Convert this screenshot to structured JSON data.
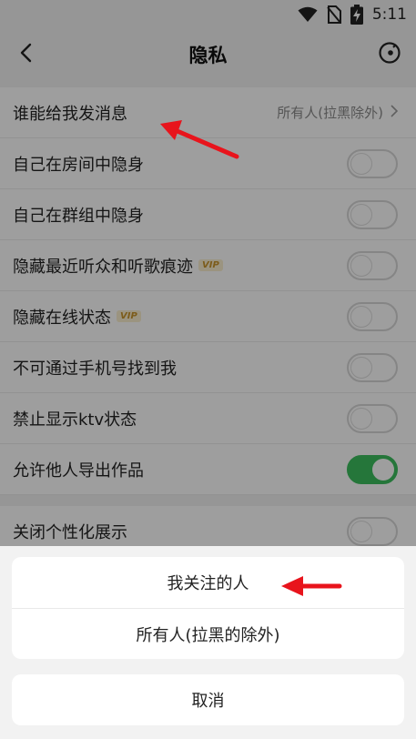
{
  "status_bar": {
    "time": "5:11"
  },
  "header": {
    "title": "隐私"
  },
  "settings": {
    "message_permission": {
      "label": "谁能给我发消息",
      "value": "所有人(拉黑除外)"
    },
    "toggles": [
      {
        "label": "自己在房间中隐身",
        "vip": "",
        "on": false
      },
      {
        "label": "自己在群组中隐身",
        "vip": "",
        "on": false
      },
      {
        "label": "隐藏最近听众和听歌痕迹",
        "vip": "VIP",
        "on": false
      },
      {
        "label": "隐藏在线状态",
        "vip": "VIP",
        "on": false
      },
      {
        "label": "不可通过手机号找到我",
        "vip": "",
        "on": false
      },
      {
        "label": "禁止显示ktv状态",
        "vip": "",
        "on": false
      },
      {
        "label": "允许他人导出作品",
        "vip": "",
        "on": true
      }
    ],
    "personalized": {
      "label": "关闭个性化展示",
      "on": false
    }
  },
  "action_sheet": {
    "options": [
      "我关注的人",
      "所有人(拉黑的除外)"
    ],
    "cancel_label": "取消"
  },
  "colors": {
    "toggle_on": "#3dbf5e",
    "annotation_arrow": "#e8141c",
    "vip": "#c9952b"
  }
}
